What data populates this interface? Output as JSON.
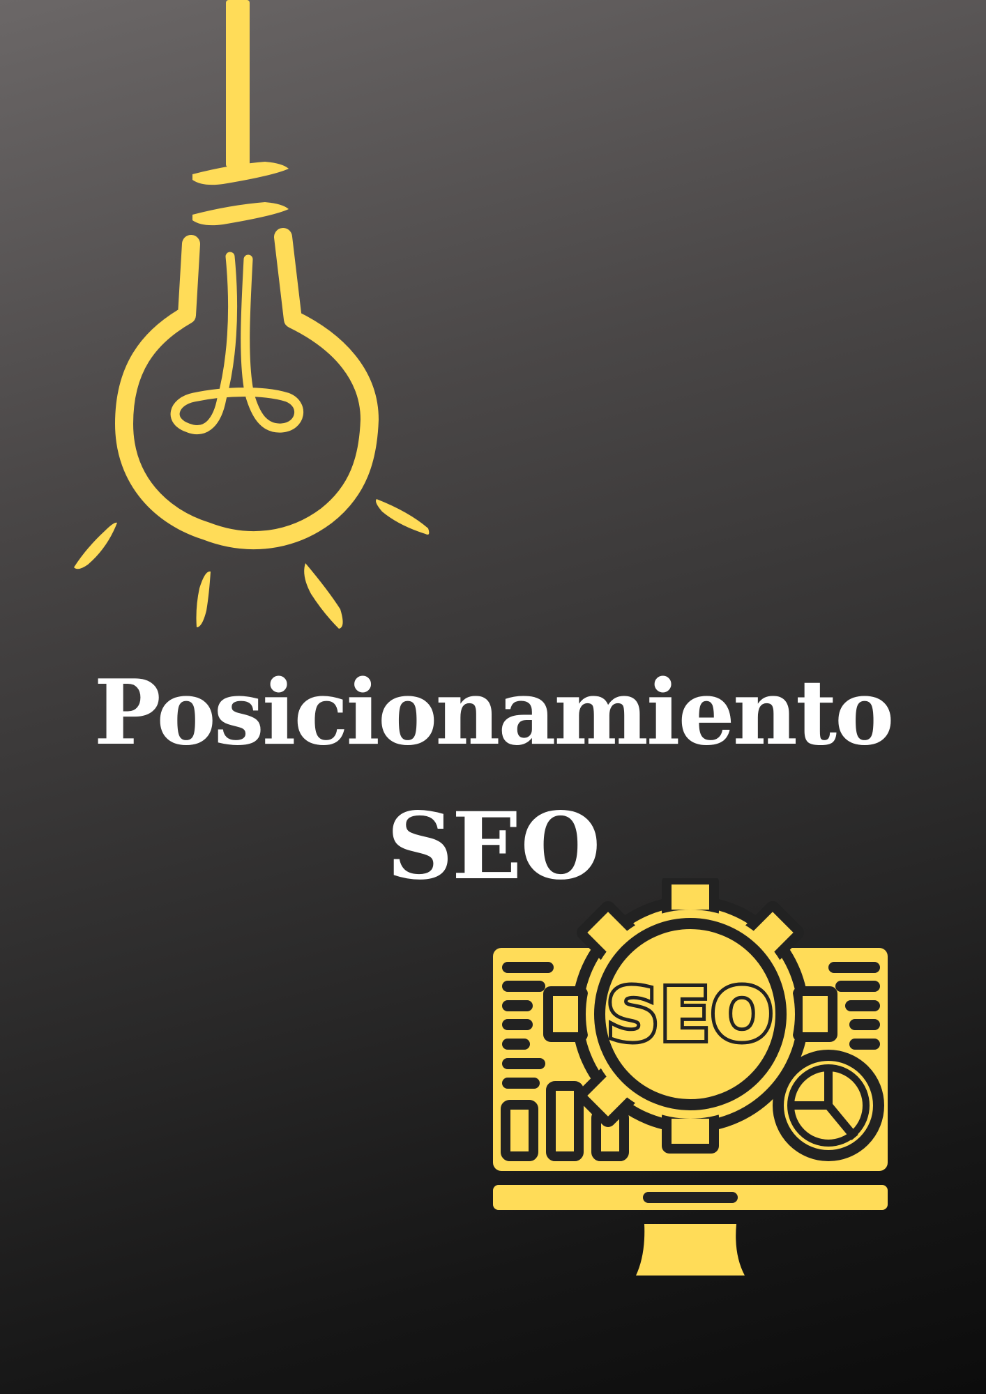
{
  "poster": {
    "background_top": "#6b6767",
    "background_bottom": "#0c0c0c",
    "accent_color": "#ffdc58"
  },
  "illustrations": {
    "top_icon": "light-bulb-icon",
    "bottom_icon": "seo-monitor-icon",
    "monitor_screen_text": "SEO"
  },
  "title": {
    "line1": "Posicionamiento",
    "line2": "SEO"
  }
}
